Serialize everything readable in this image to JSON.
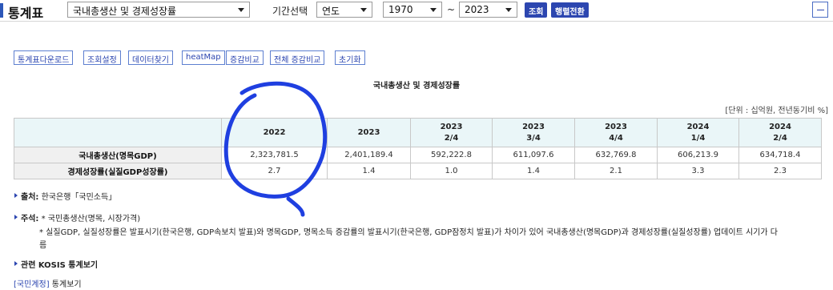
{
  "header": {
    "title": "통계표",
    "table_select": "국내총생산 및 경제성장률",
    "period_label": "기간선택",
    "period_unit": "연도",
    "start_year": "1970",
    "tilde": "~",
    "end_year": "2023",
    "search_btn": "조회",
    "pivot_btn": "행렬전환"
  },
  "toolbar": [
    "통계표다운로드",
    "조회설정",
    "데이터찾기",
    "heatMap",
    "증감비교",
    "전체 증감비교",
    "초기화"
  ],
  "table": {
    "title": "국내총생산 및 경제성장률",
    "unit": "[단위 : 십억원, 전년동기비 %]",
    "columns": [
      [
        "2022",
        ""
      ],
      [
        "2023",
        ""
      ],
      [
        "2023",
        "2/4"
      ],
      [
        "2023",
        "3/4"
      ],
      [
        "2023",
        "4/4"
      ],
      [
        "2024",
        "1/4"
      ],
      [
        "2024",
        "2/4"
      ]
    ],
    "rows": [
      {
        "label": "국내총생산(명목GDP)",
        "values": [
          "2,323,781.5",
          "2,401,189.4",
          "592,222.8",
          "611,097.6",
          "632,769.8",
          "606,213.9",
          "634,718.4"
        ]
      },
      {
        "label": "경제성장률(실질GDP성장률)",
        "values": [
          "2.7",
          "1.4",
          "1.0",
          "1.4",
          "2.1",
          "3.3",
          "2.3"
        ]
      }
    ]
  },
  "notes": {
    "source_label": "출처:",
    "source_text": "한국은행「국민소득」",
    "footnote_label": "주석:",
    "footnote_1": "* 국민총생산(명목, 시장가격)",
    "footnote_2": "* 실질GDP, 실질성장률은 발표시기(한국은행, GDP속보치 발표)와 명목GDP, 명목소득 증감률의 발표시기(한국은행, GDP잠정치 발표)가 차이가 있어 국내총생산(명목GDP)과 경제성장률(실질성장률) 업데이트 시기가 다",
    "footnote_3": "름",
    "related_label": "관련 KOSIS 통계보기",
    "related_link": "[국민계정]",
    "related_text": "통계보기"
  },
  "colors": {
    "accent": "#2c46b0",
    "header_bg": "#eaf6f8",
    "annotation": "#1f3fe0"
  }
}
